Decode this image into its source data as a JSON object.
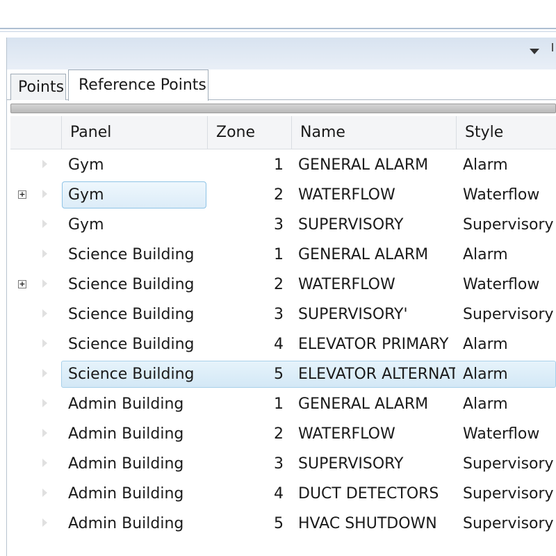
{
  "tabs": [
    {
      "label": "Points",
      "active": false
    },
    {
      "label": "Reference Points",
      "active": true
    }
  ],
  "columns": {
    "panel": "Panel",
    "zone": "Zone",
    "name": "Name",
    "style": "Style"
  },
  "rows": [
    {
      "panel": "Gym",
      "zone": "1",
      "name": "GENERAL ALARM",
      "style": "Alarm",
      "expandable": false
    },
    {
      "panel": "Gym",
      "zone": "2",
      "name": "WATERFLOW",
      "style": "Waterflow",
      "expandable": true
    },
    {
      "panel": "Gym",
      "zone": "3",
      "name": "SUPERVISORY",
      "style": "Supervisory",
      "expandable": false
    },
    {
      "panel": "Science Building",
      "zone": "1",
      "name": "GENERAL ALARM",
      "style": "Alarm",
      "expandable": false
    },
    {
      "panel": "Science Building",
      "zone": "2",
      "name": "WATERFLOW",
      "style": "Waterflow",
      "expandable": true
    },
    {
      "panel": "Science Building",
      "zone": "3",
      "name": "SUPERVISORY'",
      "style": "Supervisory",
      "expandable": false
    },
    {
      "panel": "Science Building",
      "zone": "4",
      "name": "ELEVATOR PRIMARY",
      "style": "Alarm",
      "expandable": false
    },
    {
      "panel": "Science Building",
      "zone": "5",
      "name": "ELEVATOR ALTERNAT",
      "style": "Alarm",
      "expandable": false
    },
    {
      "panel": "Admin Building",
      "zone": "1",
      "name": "GENERAL ALARM",
      "style": "Alarm",
      "expandable": false
    },
    {
      "panel": "Admin Building",
      "zone": "2",
      "name": "WATERFLOW",
      "style": "Waterflow",
      "expandable": false
    },
    {
      "panel": "Admin Building",
      "zone": "3",
      "name": "SUPERVISORY",
      "style": "Supervisory",
      "expandable": false
    },
    {
      "panel": "Admin Building",
      "zone": "4",
      "name": "DUCT DETECTORS",
      "style": "Supervisory",
      "expandable": false
    },
    {
      "panel": "Admin Building",
      "zone": "5",
      "name": "HVAC SHUTDOWN",
      "style": "Supervisory",
      "expandable": false
    }
  ],
  "expander_symbol": "+",
  "icons": {
    "header_dropdown": "chevron-down-icon",
    "row_marker": "row-arrow-icon",
    "expander": "expand-plus-icon"
  },
  "colors": {
    "selection_border": "#8ec3e6",
    "selection_fill": "#dcecf8",
    "header_bar": "#d8e3f0"
  }
}
